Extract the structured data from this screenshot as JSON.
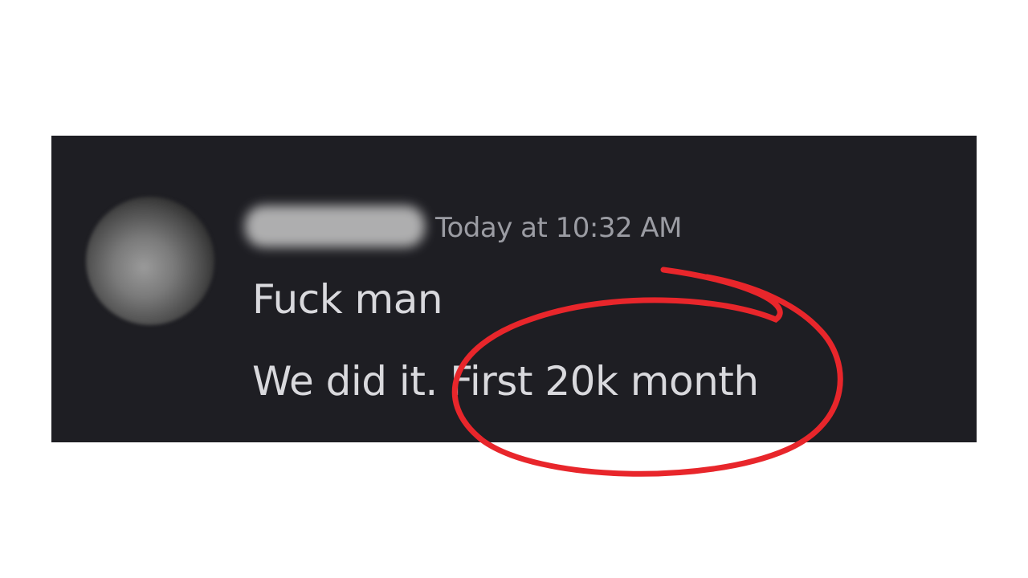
{
  "message": {
    "username": "",
    "timestamp": "Today at 10:32 AM",
    "lines": [
      "Fuck man",
      "We did it. First 20k month"
    ]
  },
  "colors": {
    "page_background": "#ffffff",
    "card_background": "#1e1e23",
    "message_text": "#d9d9dd",
    "timestamp_text": "#9b9ca3",
    "annotation_circle": "#e8262b"
  },
  "icons": {
    "avatar": "blurred-avatar",
    "username": "blurred-username"
  }
}
